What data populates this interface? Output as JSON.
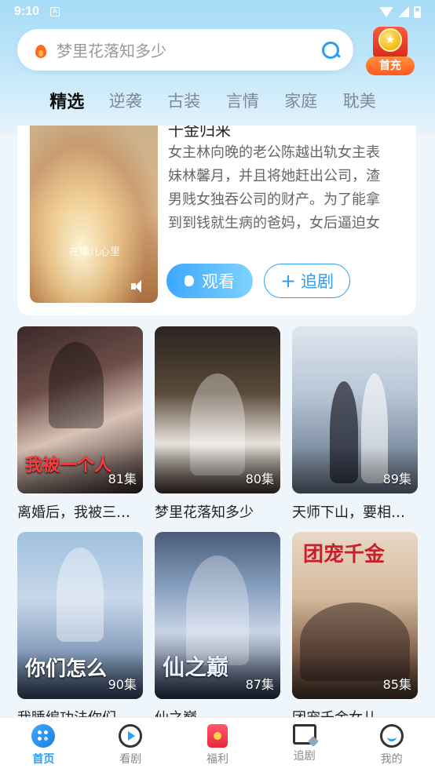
{
  "status_bar": {
    "time": "9:10",
    "notif_glyph": "A"
  },
  "search": {
    "placeholder": "梦里花落知多少"
  },
  "promo": {
    "label": "首充"
  },
  "tabs": [
    {
      "label": "精选",
      "active": true
    },
    {
      "label": "逆袭",
      "active": false
    },
    {
      "label": "古装",
      "active": false
    },
    {
      "label": "言情",
      "active": false
    },
    {
      "label": "家庭",
      "active": false
    },
    {
      "label": "耽美",
      "active": false
    }
  ],
  "featured": {
    "title": "千金归来",
    "poster_caption": "在墙儿心里",
    "description": "女主林向晚的老公陈越出轨女主表妹林馨月，并且将她赶出公司，渣男贱女独吞公司的财产。为了能拿到到钱就生病的爸妈，女后逼迫女主踏下去",
    "watch_label": "观看",
    "follow_label": "追剧",
    "follow_prefix": "+"
  },
  "dramas": [
    {
      "title": "离婚后，我被三…",
      "episodes": "81集",
      "overlay": "我被一个人"
    },
    {
      "title": "梦里花落知多少",
      "episodes": "80集"
    },
    {
      "title": "天师下山，要相…",
      "episodes": "89集"
    },
    {
      "title": "我睡编功法你们…",
      "episodes": "90集",
      "overlay": "你们怎么"
    },
    {
      "title": "仙之巅",
      "episodes": "87集",
      "overlay": "仙之巅"
    },
    {
      "title": "团宠千金女儿…",
      "episodes": "85集",
      "overlay": "团宠千金"
    }
  ],
  "bottom_nav": [
    {
      "label": "首页",
      "icon": "home-icon",
      "active": true
    },
    {
      "label": "看剧",
      "icon": "play-circle-icon",
      "active": false
    },
    {
      "label": "福利",
      "icon": "red-envelope-icon",
      "active": false
    },
    {
      "label": "追剧",
      "icon": "folder-star-icon",
      "active": false
    },
    {
      "label": "我的",
      "icon": "profile-icon",
      "active": false
    }
  ],
  "colors": {
    "accent": "#2a9df4",
    "promo": "#ff5a1f",
    "flame": "#ff6a1a"
  }
}
